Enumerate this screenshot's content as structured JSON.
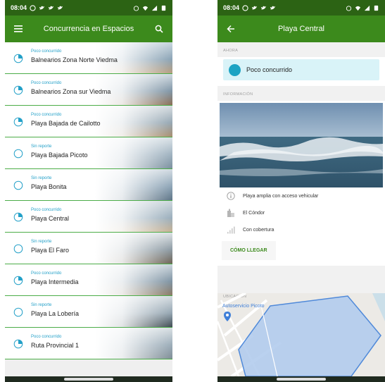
{
  "left_screen": {
    "status_bar": {
      "time": "08:04"
    },
    "app_bar": {
      "title": "Concurrencia en Espacios",
      "menu_icon": "hamburger-icon",
      "search_icon": "search-icon"
    },
    "colors": {
      "header_dark": "#2c6314",
      "header": "#3c8a1c",
      "accent": "#23a0c8",
      "divider": "#4cad48"
    },
    "items": [
      {
        "status": "Poco concurrido",
        "name": "Balnearios Zona Norte Viedma",
        "level": 0.25
      },
      {
        "status": "Poco concurrido",
        "name": "Balnearios Zona sur Viedma",
        "level": 0.25
      },
      {
        "status": "Poco concurrido",
        "name": "Playa Bajada de Cailotto",
        "level": 0.25
      },
      {
        "status": "Sin reporte",
        "name": "Playa Bajada Picoto",
        "level": 0
      },
      {
        "status": "Sin reporte",
        "name": "Playa Bonita",
        "level": 0
      },
      {
        "status": "Poco concurrido",
        "name": "Playa Central",
        "level": 0.25
      },
      {
        "status": "Sin reporte",
        "name": "Playa El Faro",
        "level": 0
      },
      {
        "status": "Poco concurrido",
        "name": "Playa Intermedia",
        "level": 0.25
      },
      {
        "status": "Sin reporte",
        "name": "Playa La Lobería",
        "level": 0
      },
      {
        "status": "Poco concurrido",
        "name": "Ruta Provincial 1",
        "level": 0.25
      }
    ]
  },
  "right_screen": {
    "status_bar": {
      "time": "08:04"
    },
    "app_bar": {
      "title": "Playa Central",
      "back_icon": "back-arrow-icon"
    },
    "now_section": {
      "label": "AHORA",
      "status": "Poco concurrido",
      "color": "#1ca3c3"
    },
    "info_section": {
      "label": "INFORMACIÓN",
      "lines": [
        {
          "icon": "info-icon",
          "text": "Playa amplia con acceso vehicular"
        },
        {
          "icon": "buildings-icon",
          "text": "El Cóndor"
        },
        {
          "icon": "signal-icon",
          "text": "Con cobertura"
        }
      ],
      "directions_label": "CÓMO LLEGAR"
    },
    "location_section": {
      "label": "UBICACIÓN",
      "map_label": "Autoservicio Picoto",
      "map_pin_icon": "map-pin-icon"
    }
  }
}
